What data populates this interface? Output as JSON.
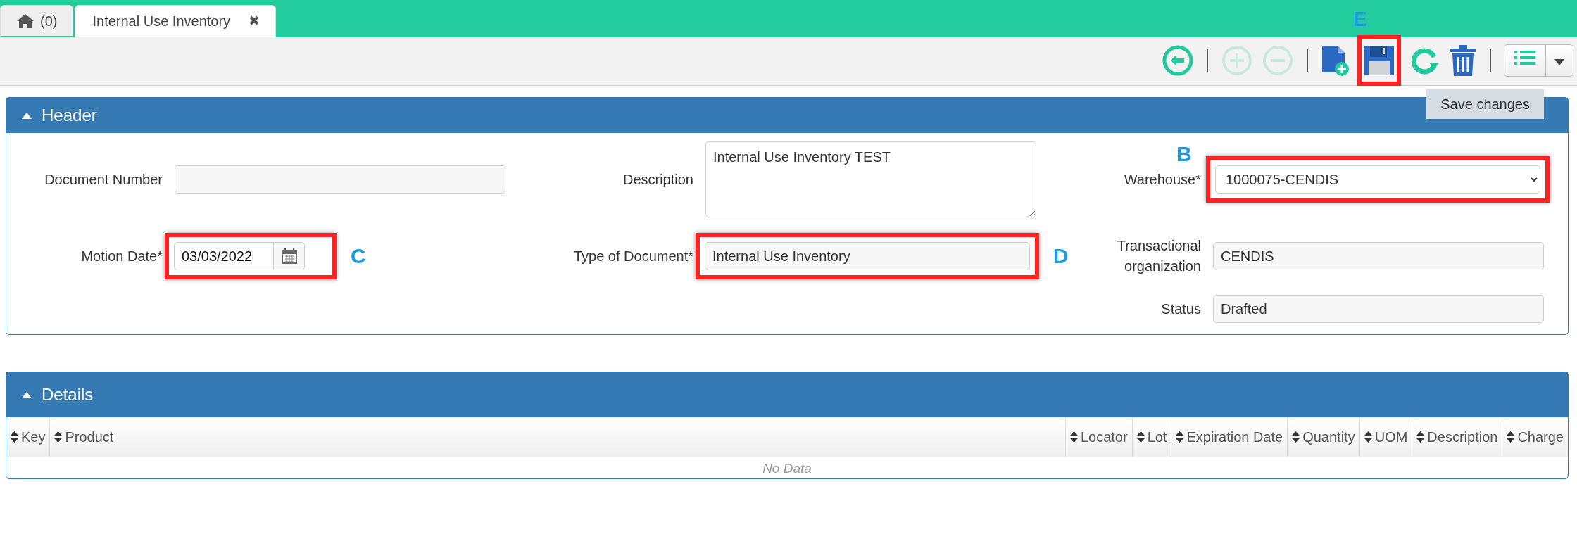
{
  "tabs": [
    {
      "kind": "home",
      "label": "(0)",
      "selected": false
    },
    {
      "kind": "document",
      "label": "Internal Use Inventory",
      "close": "✖",
      "selected": true
    }
  ],
  "toolbar": {
    "items": [
      {
        "kind": "back",
        "disabled": false
      },
      {
        "kind": "separator"
      },
      {
        "kind": "add",
        "disabled": true
      },
      {
        "kind": "remove",
        "disabled": true
      },
      {
        "kind": "separator"
      },
      {
        "kind": "new",
        "disabled": false
      },
      {
        "kind": "save",
        "disabled": false,
        "highlighted": true,
        "annotation": "E"
      },
      {
        "kind": "refresh",
        "disabled": false
      },
      {
        "kind": "delete",
        "disabled": false
      },
      {
        "kind": "separator"
      },
      {
        "kind": "list",
        "disabled": false
      }
    ],
    "tooltip": "Save changes"
  },
  "header_panel": {
    "title": "Header",
    "expanded": true,
    "rows": [
      [
        {
          "label": "Document Number",
          "kind": "text",
          "readonly": true,
          "highlighted": false
        },
        {
          "label": "Description",
          "kind": "textarea",
          "value": "Internal Use Inventory TEST",
          "readonly": false,
          "highlighted": false
        },
        {
          "label": "Warehouse*",
          "kind": "select",
          "value": "1000075-CENDIS",
          "readonly": false,
          "highlighted": true,
          "annotation": "B"
        }
      ],
      [
        {
          "label": "Motion Date*",
          "kind": "date",
          "value": "03/03/2022",
          "readonly": false,
          "highlighted": true,
          "annotation": "C"
        },
        {
          "label": "Type of Document*",
          "kind": "text",
          "value": "Internal Use Inventory",
          "readonly": true,
          "highlighted": true,
          "annotation": "D"
        },
        {
          "label": "Transactional organization",
          "kind": "text",
          "value": "CENDIS",
          "readonly": true,
          "highlighted": false
        }
      ],
      [
        "",
        "",
        {
          "label": "Status",
          "kind": "text",
          "value": "Drafted",
          "readonly": true,
          "highlighted": false
        }
      ]
    ]
  },
  "details_panel": {
    "title": "Details",
    "expanded": true,
    "table": {
      "columns": [
        {
          "label": "Key",
          "sortable": true
        },
        {
          "label": "Product",
          "sortable": true
        },
        {
          "label": "Locator",
          "sortable": true
        },
        {
          "label": "Lot",
          "sortable": true
        },
        {
          "label": "Expiration Date",
          "sortable": true
        },
        {
          "label": "Quantity",
          "sortable": true
        },
        {
          "label": "UOM",
          "sortable": true
        },
        {
          "label": "Description",
          "sortable": true
        },
        {
          "label": "Charge",
          "sortable": true
        }
      ],
      "empty_text": "No Data"
    }
  }
}
